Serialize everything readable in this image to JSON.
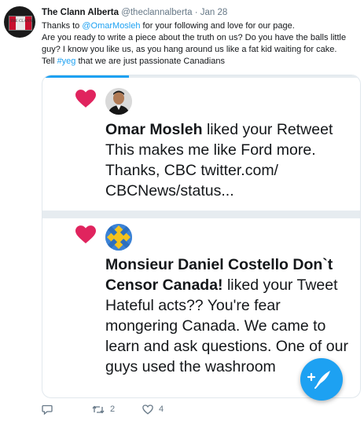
{
  "tweet": {
    "name": "The Clann Alberta",
    "handle": "@theclannalberta",
    "separator": "·",
    "date": "Jan 28",
    "text_1": "Thanks to ",
    "mention": "@OmarMosleh",
    "text_2": " for your following and love for our page.",
    "line_2": "Are you ready to write a piece about the truth on us? Do you have the balls little guy? I know you like us, as you hang around us like a fat kid waiting for cake.",
    "text_3": "Tell ",
    "hashtag": "#yeg",
    "text_4": " that we are just passionate Canadians",
    "avatar_text": "THE CLANN"
  },
  "notifications": [
    {
      "user": "Omar Mosleh",
      "action": " liked your Retweet",
      "content": "This makes me like Ford more. Thanks, CBC twitter.com/ CBCNews/status..."
    },
    {
      "user": "Monsieur Daniel Costello Don`t Censor Canada!",
      "action": " liked your Tweet",
      "content": "Hateful acts?? You're fear mongering Canada. We came to learn and ask questions. One of our guys used the washroom"
    }
  ],
  "actions": {
    "reply_count": "",
    "retweet_count": "2",
    "like_count": "4"
  },
  "colors": {
    "accent": "#1da1f2",
    "heart": "#e0245e",
    "muted": "#657786"
  }
}
